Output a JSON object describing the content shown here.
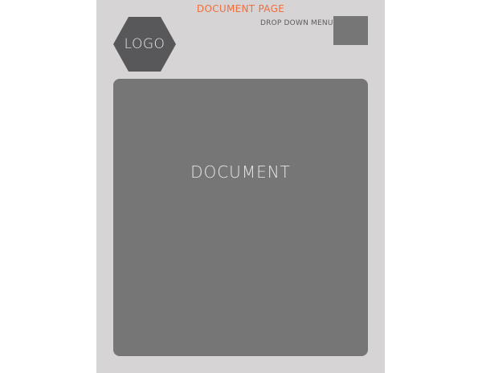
{
  "page": {
    "title": "DOCUMENT PAGE"
  },
  "header": {
    "logo_text": "LOGO",
    "dropdown_label": "DROP DOWN MENU"
  },
  "main": {
    "document_label": "DOCUMENT"
  },
  "colors": {
    "background": "#d6d4d4",
    "title_accent": "#f26d3d",
    "logo_fill": "#58585a",
    "block_fill": "#767677"
  },
  "icons": {
    "logo": "hexagon-logo-icon",
    "dropdown": "dropdown-menu-box"
  }
}
